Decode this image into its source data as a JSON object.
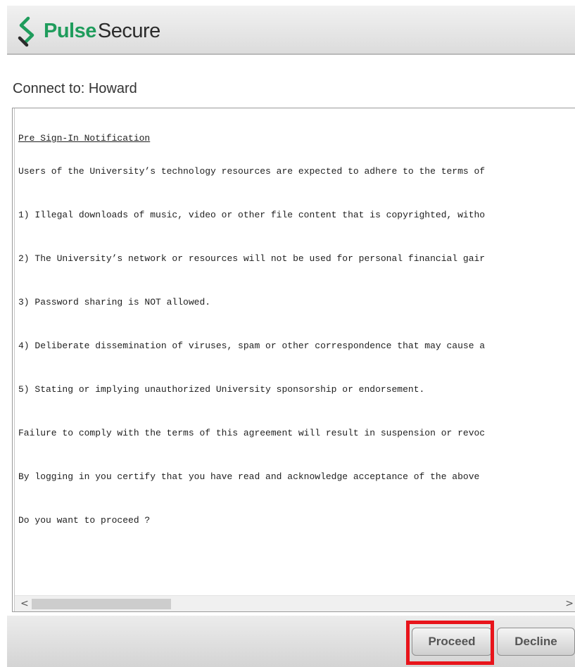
{
  "header": {
    "brand_pulse": "Pulse",
    "brand_secure": "Secure",
    "logo_icon": "pulse-secure-logo-icon"
  },
  "connect_label": "Connect to: Howard",
  "notice": {
    "title": "Pre Sign-In Notification",
    "lines": [
      "Users of the University’s technology resources are expected to adhere to the terms of",
      "1) Illegal downloads of music, video or other file content that is copyrighted, witho",
      "2) The University’s network or resources will not be used for personal financial gair",
      "3) Password sharing is NOT allowed.",
      "4) Deliberate dissemination of viruses, spam or other correspondence that may cause a",
      "5) Stating or implying unauthorized University sponsorship or endorsement.",
      "Failure to comply with the terms of this agreement will result in suspension or revoc",
      "By logging in you certify that you have read and acknowledge acceptance of the above",
      "Do you want to proceed ?"
    ]
  },
  "scrollbar": {
    "left_arrow": "<",
    "right_arrow": ">"
  },
  "buttons": {
    "proceed": "Proceed",
    "decline": "Decline"
  },
  "colors": {
    "brand_green": "#1f9c5c",
    "highlight": "#e8141b"
  }
}
